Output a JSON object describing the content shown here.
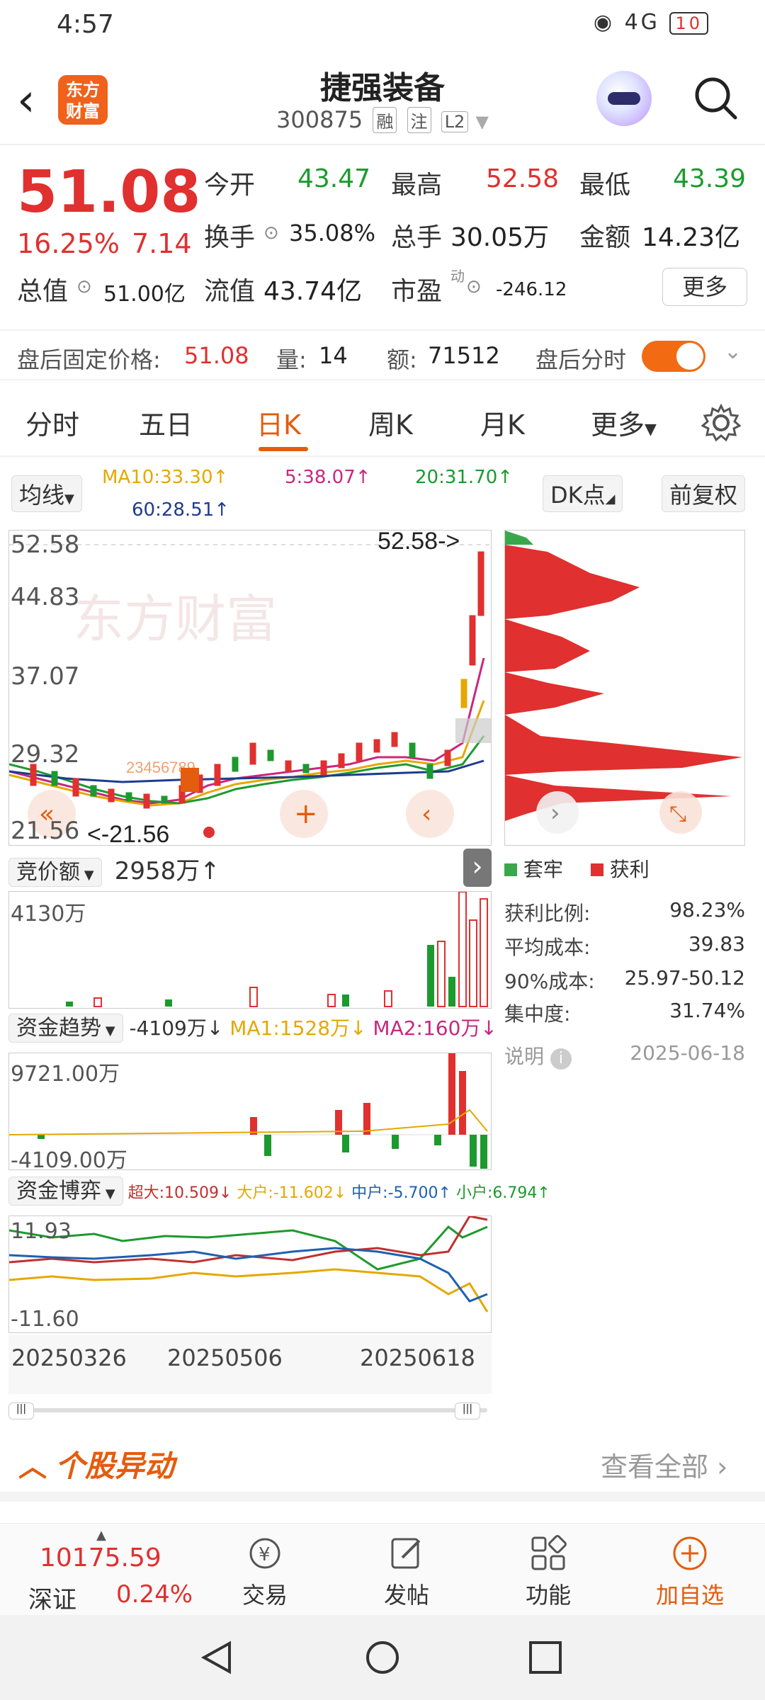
{
  "status": {
    "time": "4:57",
    "battery": "10",
    "signal": "4G"
  },
  "header": {
    "title": "捷强装备",
    "code": "300875",
    "tags": [
      "融",
      "注",
      "L2"
    ],
    "logo_text": "东方财富"
  },
  "quote": {
    "price": "51.08",
    "change_pct": "16.25%",
    "change": "7.14",
    "open_label": "今开",
    "open": "43.47",
    "high_label": "最高",
    "high": "52.58",
    "low_label": "最低",
    "low": "43.39",
    "turnover_label": "换手",
    "turnover": "35.08%",
    "volume_label": "总手",
    "volume": "30.05万",
    "amount_label": "金额",
    "amount": "14.23亿",
    "mcap_label": "总值",
    "mcap": "51.00亿",
    "float_label": "流值",
    "float": "43.74亿",
    "pe_label": "市盈",
    "pe_sup": "动",
    "pe": "-246.12",
    "more": "更多"
  },
  "afterhours": {
    "price_label": "盘后固定价格:",
    "price": "51.08",
    "qty_label": "量:",
    "qty": "14",
    "amt_label": "额:",
    "amt": "71512",
    "toggle_label": "盘后分时"
  },
  "tabs": [
    "分时",
    "五日",
    "日K",
    "周K",
    "月K",
    "更多"
  ],
  "ma": {
    "selector": "均线",
    "ma10": "MA10:33.30↑",
    "ma5": "5:38.07↑",
    "ma20": "20:31.70↑",
    "ma60": "60:28.51↑",
    "dk": "DK点",
    "adjust": "前复权"
  },
  "chart": {
    "y_labels": [
      "52.58",
      "44.83",
      "37.07",
      "29.32",
      "21.56"
    ],
    "max_marker": "52.58->",
    "min_marker": "<-21.56",
    "seq_marker": "23456789",
    "watermark": "东方财富"
  },
  "auction": {
    "label": "竞价额",
    "value": "2958万↑",
    "max": "4130万"
  },
  "fund_trend": {
    "label": "资金趋势",
    "value": "-4109万↓",
    "ma1": "MA1:1528万↓",
    "ma2": "MA2:160万↓",
    "top": "9721.00万",
    "bottom": "-4109.00万"
  },
  "fund_game": {
    "label": "资金博弈",
    "super": "超大:10.509↓",
    "big": "大户:-11.602↓",
    "mid": "中户:-5.700↑",
    "small": "小户:6.794↑",
    "top": "11.93",
    "bottom": "-11.60"
  },
  "dates": [
    "20250326",
    "20250506",
    "20250618"
  ],
  "chips": {
    "legend_trap": "套牢",
    "legend_profit": "获利",
    "rows": [
      {
        "label": "获利比例:",
        "value": "98.23%"
      },
      {
        "label": "平均成本:",
        "value": "39.83"
      },
      {
        "label": "90%成本:",
        "value": "25.97-50.12"
      },
      {
        "label": "集中度:",
        "value": "31.74%"
      }
    ],
    "note": "说明",
    "date": "2025-06-18"
  },
  "anomaly": {
    "title": "个股异动",
    "see_all": "查看全部"
  },
  "bottom": {
    "index_value": "10175.59",
    "index_name": "深证",
    "index_pct": "0.24%",
    "trade": "交易",
    "post": "发帖",
    "func": "功能",
    "add": "加自选"
  },
  "colors": {
    "up": "#e0302f",
    "down": "#1c9a2e",
    "accent": "#e45c0e"
  }
}
